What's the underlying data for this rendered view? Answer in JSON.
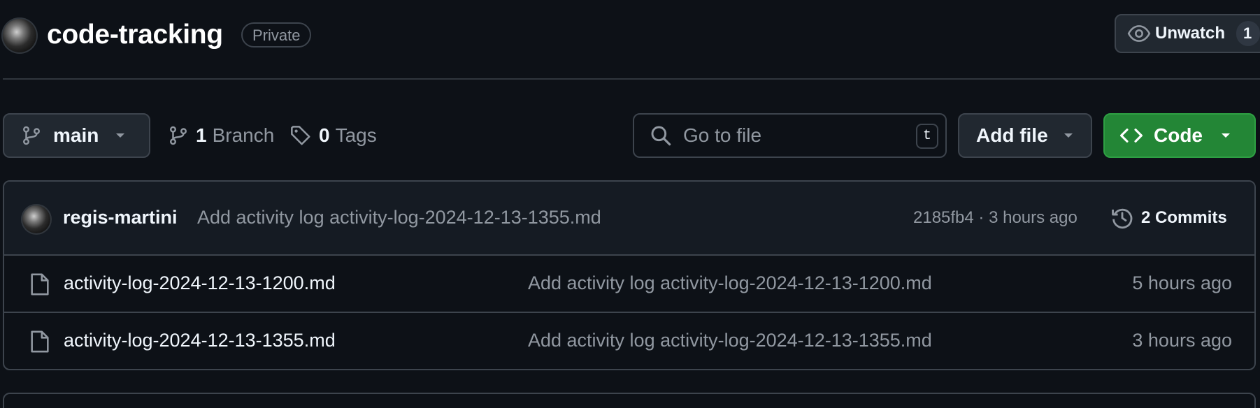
{
  "repo": {
    "name": "code-tracking",
    "visibility": "Private",
    "owner_avatar": "avatar"
  },
  "watch": {
    "label": "Unwatch",
    "count": "1",
    "icon": "eye-icon"
  },
  "toolbar": {
    "branch_name": "main",
    "branch_count": "1",
    "branch_label": "Branch",
    "tag_count": "0",
    "tag_label": "Tags",
    "search_placeholder": "Go to file",
    "search_shortcut": "t",
    "add_file_label": "Add file",
    "code_label": "Code"
  },
  "latest_commit": {
    "author": "regis-martini",
    "message": "Add activity log activity-log-2024-12-13-1355.md",
    "meta": "2185fb4 · 3 hours ago",
    "commits_label": "2 Commits"
  },
  "files": [
    {
      "name": "activity-log-2024-12-13-1200.md",
      "commit": "Add activity log activity-log-2024-12-13-1200.md",
      "age": "5 hours ago"
    },
    {
      "name": "activity-log-2024-12-13-1355.md",
      "commit": "Add activity log activity-log-2024-12-13-1355.md",
      "age": "3 hours ago"
    }
  ],
  "colors": {
    "background": "#0d1117",
    "border": "#3d444d",
    "code_button": "#238636",
    "muted_text": "#9198a1"
  }
}
